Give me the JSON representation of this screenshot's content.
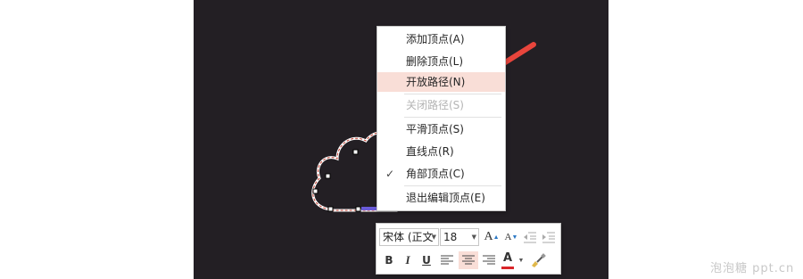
{
  "context_menu": {
    "items": [
      {
        "label": "添加顶点(A)",
        "state": "normal"
      },
      {
        "label": "删除顶点(L)",
        "state": "normal"
      },
      {
        "label": "开放路径(N)",
        "state": "highlighted"
      },
      {
        "label": "关闭路径(S)",
        "state": "disabled"
      },
      {
        "label": "平滑顶点(S)",
        "state": "normal"
      },
      {
        "label": "直线点(R)",
        "state": "normal"
      },
      {
        "label": "角部顶点(C)",
        "state": "checked"
      },
      {
        "label": "退出编辑顶点(E)",
        "state": "normal"
      }
    ],
    "check_glyph": "✓"
  },
  "mini_toolbar": {
    "font_name": "宋体 (正文",
    "font_size": "18",
    "grow_font": "A",
    "shrink_font": "A",
    "bold": "B",
    "italic": "I",
    "underline": "U",
    "font_color_label": "A"
  },
  "colors": {
    "slide_bg": "#231f24",
    "highlight": "#f9ded7",
    "arrow": "#e8453c",
    "cloud_stroke": "#c0392b",
    "font_color_bar": "#d9262a"
  },
  "icons": [
    "red-arrow-icon",
    "cloud-shape",
    "decrease-indent-icon",
    "increase-indent-icon",
    "align-left-icon",
    "align-center-icon",
    "align-right-icon",
    "format-painter-icon"
  ],
  "watermark": "泡泡糖 ppt.cn"
}
